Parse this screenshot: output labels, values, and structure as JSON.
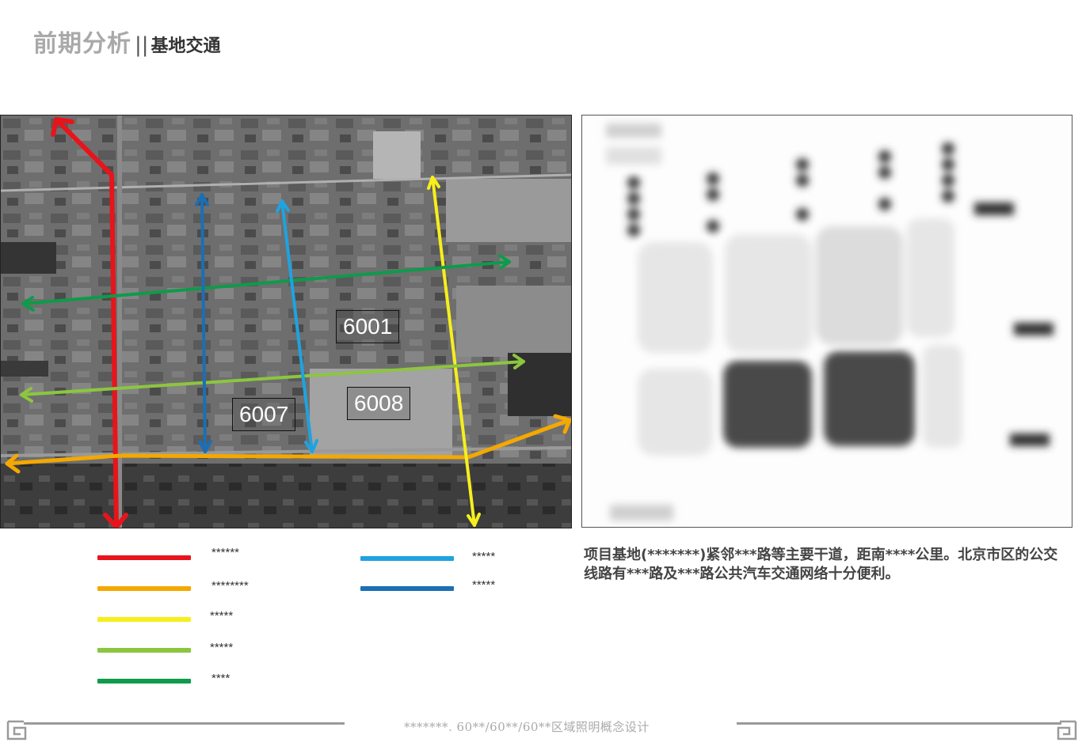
{
  "header": {
    "title_main": "前期分析",
    "separator": "||",
    "title_sub": "基地交通"
  },
  "map": {
    "labels": [
      "6001",
      "6007",
      "6008"
    ]
  },
  "legend": {
    "items": [
      {
        "text": "******",
        "color": "#e8141b"
      },
      {
        "text": "********",
        "color": "#f5a800"
      },
      {
        "text": "*****",
        "color": "#f6ef1c"
      },
      {
        "text": "*****",
        "color": "#8cc63f"
      },
      {
        "text": "****",
        "color": "#0e9b4a"
      },
      {
        "text": "*****",
        "color": "#1ea3e0"
      },
      {
        "text": "*****",
        "color": "#1b6fb5"
      }
    ]
  },
  "description": "项目基地(*******)紧邻***路等主要干道，距南****公里。北京市区的公交线路有***路及***路公共汽车交通网络十分便利。",
  "footer": {
    "text": "*******. 60**/60**/60**区域照明概念设计"
  }
}
